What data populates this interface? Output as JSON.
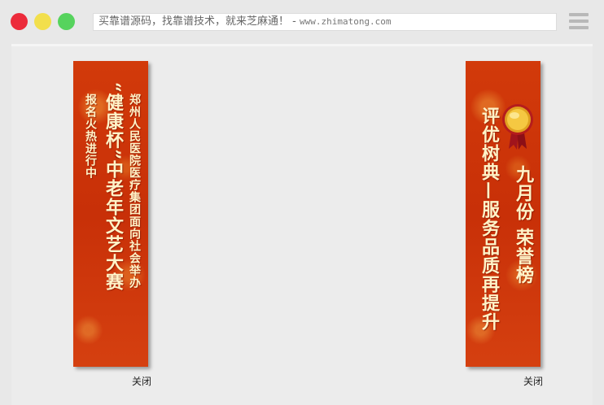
{
  "window": {
    "address_text": "买靠谱源码，找靠谱技术，就来芝麻通！ - ",
    "address_url": "www.zhimatong.com"
  },
  "left_couplet": {
    "line1": "郑州人民医院医疗集团面向社会举办",
    "line2": "“健康杯”中老年文艺大赛",
    "line3": "报名火热进行中",
    "close_label": "关闭"
  },
  "right_couplet": {
    "line1": "九月份 荣誉榜",
    "line2": "评优树典—服务品质再提升",
    "medal_icon": "medal-icon",
    "close_label": "关闭"
  },
  "colors": {
    "banner_red": "#c83008",
    "banner_text": "#fff3c8",
    "traffic_red": "#ec2b3b",
    "traffic_yellow": "#f2df4c",
    "traffic_green": "#56d35d"
  }
}
